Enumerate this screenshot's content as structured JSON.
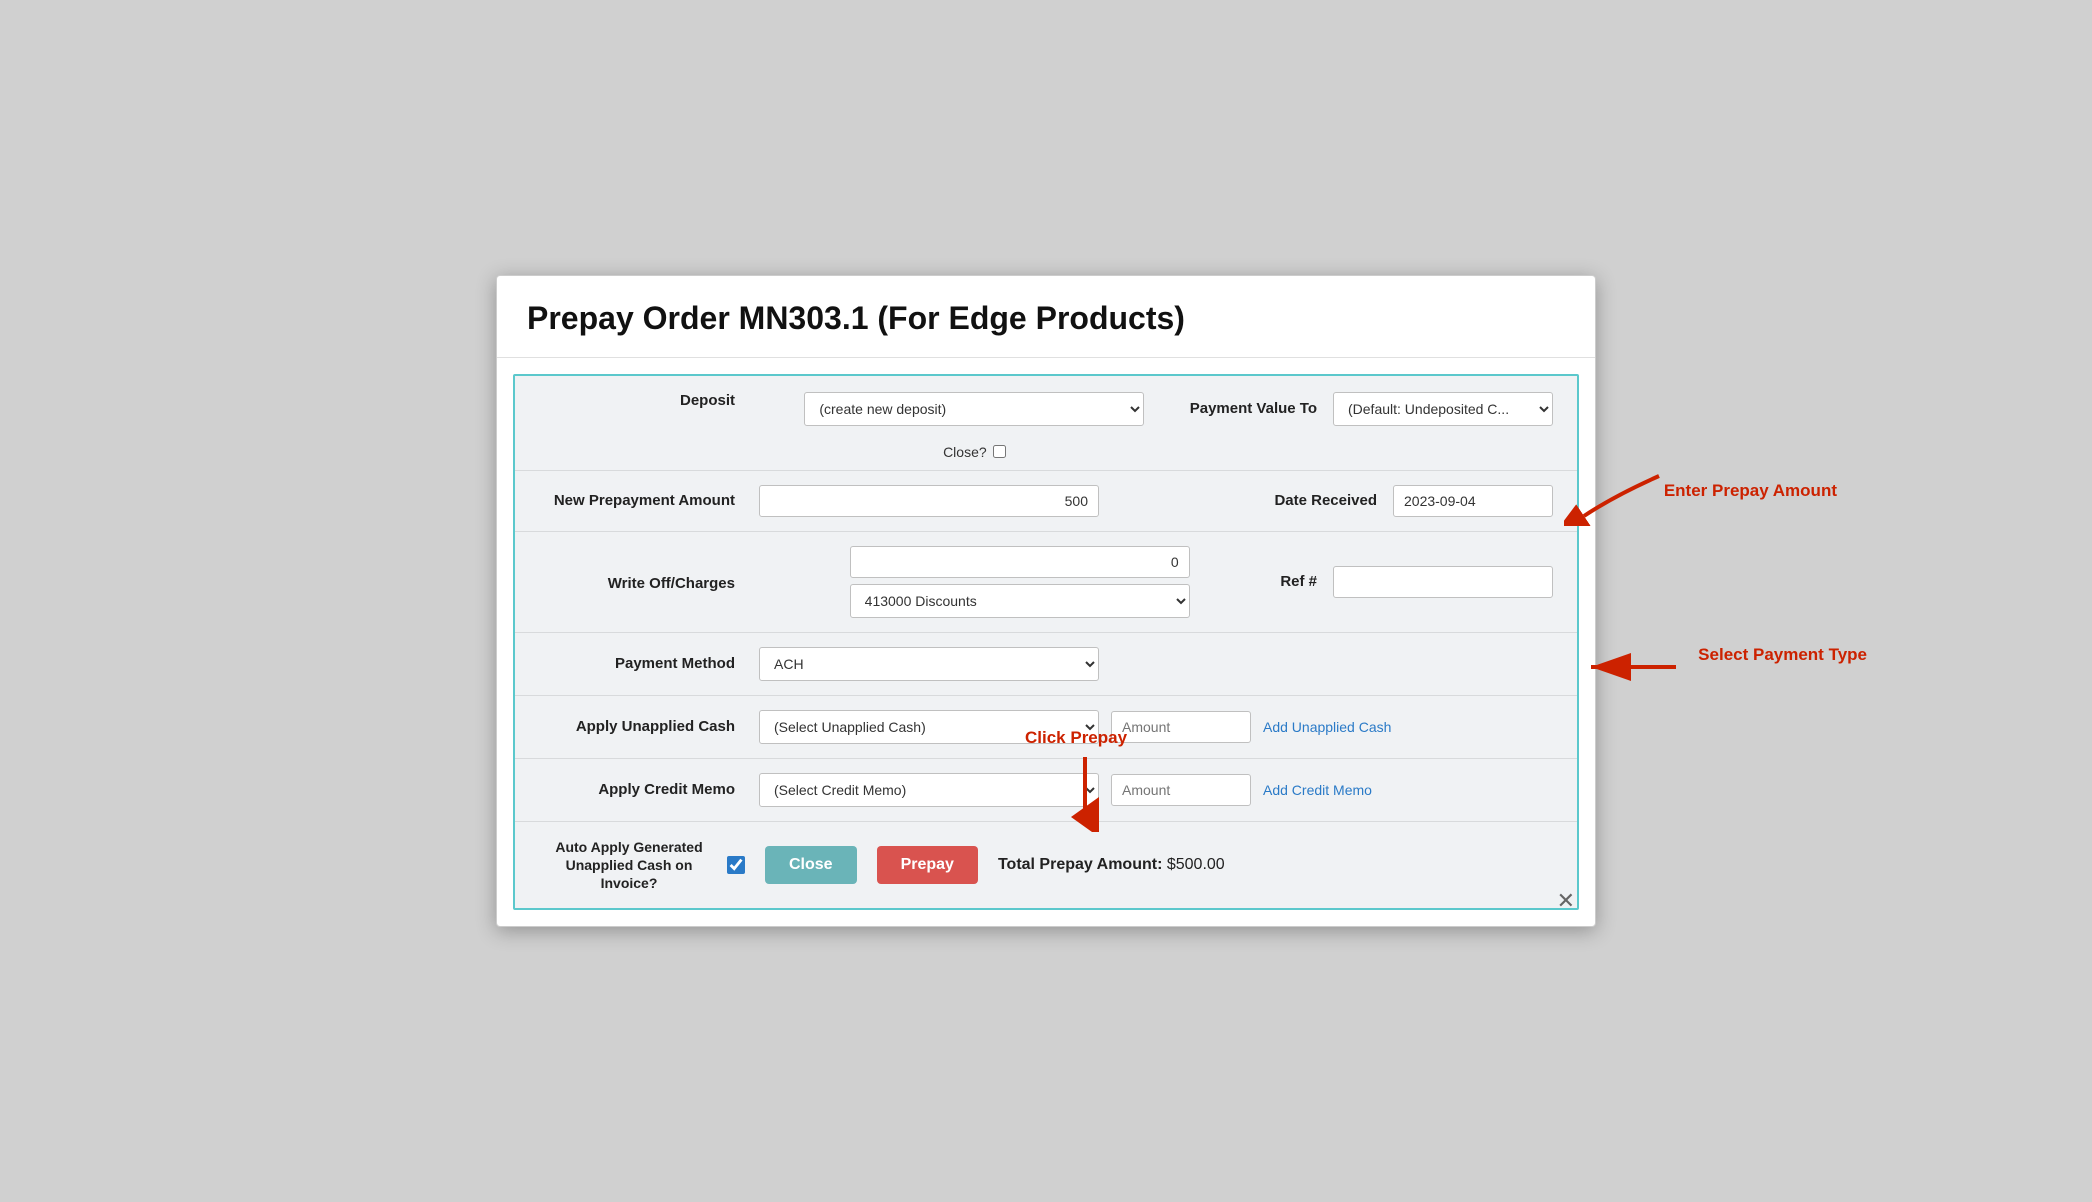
{
  "page": {
    "title": "Prepay Order MN303.1 (For Edge Products)"
  },
  "form": {
    "deposit_label": "Deposit",
    "deposit_options": [
      "(create new deposit)"
    ],
    "deposit_selected": "(create new deposit)",
    "close_label": "Close?",
    "payment_value_to_label": "Payment Value To",
    "payment_value_options": [
      "(Default: Undeposited C..."
    ],
    "payment_value_selected": "(Default: Undeposited C...",
    "new_prepayment_label": "New Prepayment Amount",
    "new_prepayment_value": "500",
    "date_received_label": "Date Received",
    "date_received_value": "2023-09-04",
    "write_off_label": "Write Off/Charges",
    "write_off_value": "0",
    "write_off_account_options": [
      "413000 Discounts"
    ],
    "write_off_account_selected": "413000 Discounts",
    "ref_label": "Ref #",
    "ref_value": "",
    "payment_method_label": "Payment Method",
    "payment_method_options": [
      "ACH"
    ],
    "payment_method_selected": "ACH",
    "apply_unapplied_label": "Apply Unapplied Cash",
    "unapplied_options": [
      "(Select Unapplied Cash)"
    ],
    "unapplied_selected": "(Select Unapplied Cash)",
    "unapplied_amount_placeholder": "Amount",
    "add_unapplied_label": "Add Unapplied Cash",
    "apply_credit_label": "Apply Credit Memo",
    "credit_options": [
      "(Select Credit Memo)"
    ],
    "credit_selected": "(Select Credit Memo)",
    "credit_amount_placeholder": "Amount",
    "add_credit_label": "Add Credit Memo",
    "auto_apply_label": "Auto Apply Generated Unapplied Cash on Invoice?",
    "close_button": "Close",
    "prepay_button": "Prepay",
    "total_prepay_label": "Total Prepay Amount:",
    "total_prepay_value": "$500.00",
    "close_x": "✕"
  },
  "annotations": {
    "enter_prepay": "Enter Prepay Amount",
    "select_payment": "Select Payment Type",
    "click_prepay": "Click Prepay"
  }
}
